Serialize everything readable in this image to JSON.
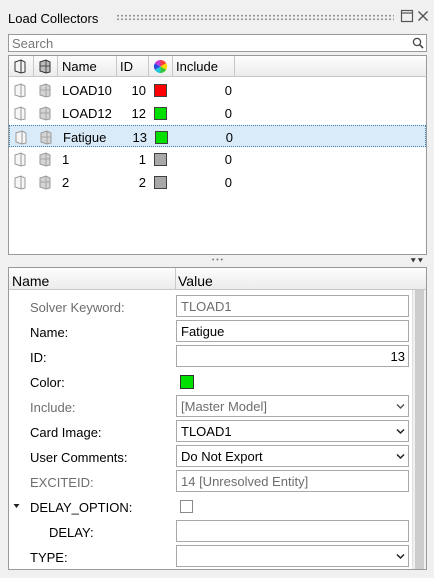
{
  "panel": {
    "title": "Load Collectors"
  },
  "search": {
    "placeholder": "Search",
    "value": ""
  },
  "list": {
    "headers": {
      "name": "Name",
      "id": "ID",
      "include": "Include"
    },
    "rows": [
      {
        "name": "LOAD10",
        "id": "10",
        "color": "#ff0000",
        "include": "0",
        "selected": false
      },
      {
        "name": "LOAD12",
        "id": "12",
        "color": "#00e000",
        "include": "0",
        "selected": false
      },
      {
        "name": "Fatigue",
        "id": "13",
        "color": "#00e000",
        "include": "0",
        "selected": true
      },
      {
        "name": "1",
        "id": "1",
        "color": "#a8a8a8",
        "include": "0",
        "selected": false
      },
      {
        "name": "2",
        "id": "2",
        "color": "#a8a8a8",
        "include": "0",
        "selected": false
      }
    ]
  },
  "props": {
    "headers": {
      "name": "Name",
      "value": "Value"
    },
    "solver_keyword": {
      "label": "Solver Keyword:",
      "value": "TLOAD1"
    },
    "name": {
      "label": "Name:",
      "value": "Fatigue"
    },
    "id": {
      "label": "ID:",
      "value": "13"
    },
    "color": {
      "label": "Color:",
      "value": "#00e000"
    },
    "include": {
      "label": "Include:",
      "value": "[Master Model]"
    },
    "card_image": {
      "label": "Card Image:",
      "value": "TLOAD1"
    },
    "user_comments": {
      "label": "User Comments:",
      "value": "Do Not Export"
    },
    "exciteid": {
      "label": "EXCITEID:",
      "value": "14 [Unresolved Entity]"
    },
    "delay_option": {
      "label": "DELAY_OPTION:",
      "checked": false
    },
    "delay": {
      "label": "DELAY:",
      "value": ""
    },
    "type": {
      "label": "TYPE:",
      "value": ""
    }
  }
}
